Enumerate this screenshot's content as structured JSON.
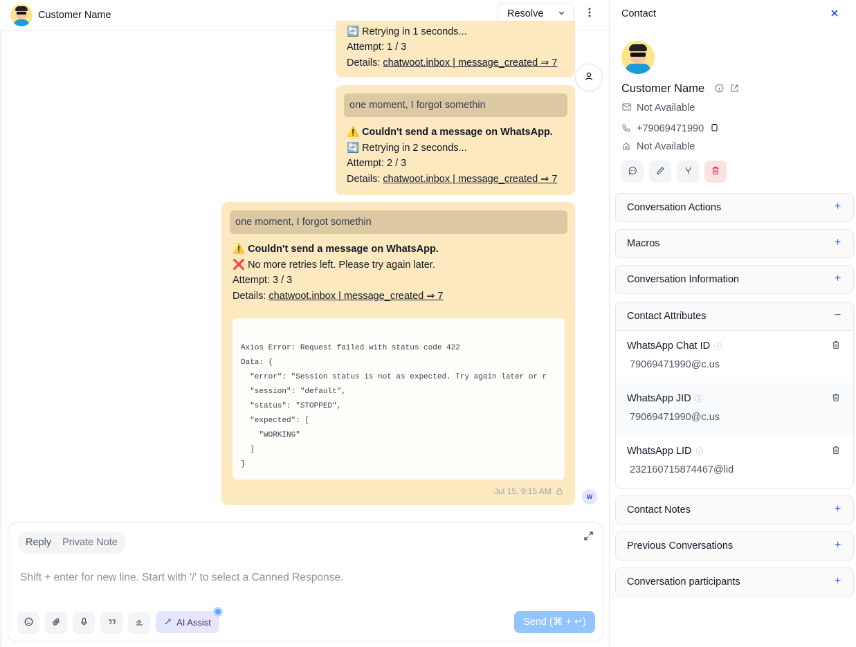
{
  "header": {
    "contact_name": "Customer Name",
    "resolve_label": "Resolve",
    "chevron_icon": "chevron-down-icon",
    "menu_icon": "kebab-menu-icon"
  },
  "messages": [
    {
      "retry_line": "🔄 Retrying in 1 seconds...",
      "attempt": "Attempt: 1 / 3",
      "details_label": "Details:",
      "details_link": "chatwoot.inbox | message_created ⇒ 7"
    },
    {
      "quote": "one moment, I forgot somethin",
      "warning": "⚠️ Couldn't send a message on WhatsApp.",
      "retry_line": "🔄 Retrying in 2 seconds...",
      "attempt": "Attempt: 2 / 3",
      "details_label": "Details:",
      "details_link": "chatwoot.inbox | message_created ⇒ 7"
    },
    {
      "quote": "one moment, I forgot somethin",
      "warning": "⚠️ Couldn't send a message on WhatsApp.",
      "retry_line": "❌ No more retries left. Please try again later.",
      "attempt": "Attempt: 3 / 3",
      "details_label": "Details:",
      "details_link": "chatwoot.inbox | message_created ⇒ 7",
      "code": "Axios Error: Request failed with status code 422\nData: {\n  \"error\": \"Session status is not as expected. Try again later or r\n  \"session\": \"default\",\n  \"status\": \"STOPPED\",\n  \"expected\": [\n    \"WORKING\"\n  ]\n}",
      "timestamp": "Jul 15, 9:15 AM",
      "sender_initial": "W"
    }
  ],
  "reply": {
    "mode_reply": "Reply",
    "mode_private": "Private Note",
    "placeholder": "Shift + enter for new line. Start with '/' to select a Canned Response.",
    "ai_assist": "AI Assist",
    "send": "Send (⌘ + ↵)"
  },
  "sidebar": {
    "title": "Contact",
    "contact_name": "Customer Name",
    "email": "Not Available",
    "phone": "+79069471990",
    "company": "Not Available",
    "sections": [
      {
        "title": "Conversation Actions",
        "icon": "+"
      },
      {
        "title": "Macros",
        "icon": "+"
      },
      {
        "title": "Conversation Information",
        "icon": "+"
      },
      {
        "title": "Contact Attributes",
        "icon": "−"
      },
      {
        "title": "Contact Notes",
        "icon": "+"
      },
      {
        "title": "Previous Conversations",
        "icon": "+"
      },
      {
        "title": "Conversation participants",
        "icon": "+"
      }
    ],
    "attributes": [
      {
        "key": "WhatsApp Chat ID",
        "value": "79069471990@c.us"
      },
      {
        "key": "WhatsApp JID",
        "value": "79069471990@c.us"
      },
      {
        "key": "WhatsApp LID",
        "value": "232160715874467@lid"
      }
    ]
  }
}
